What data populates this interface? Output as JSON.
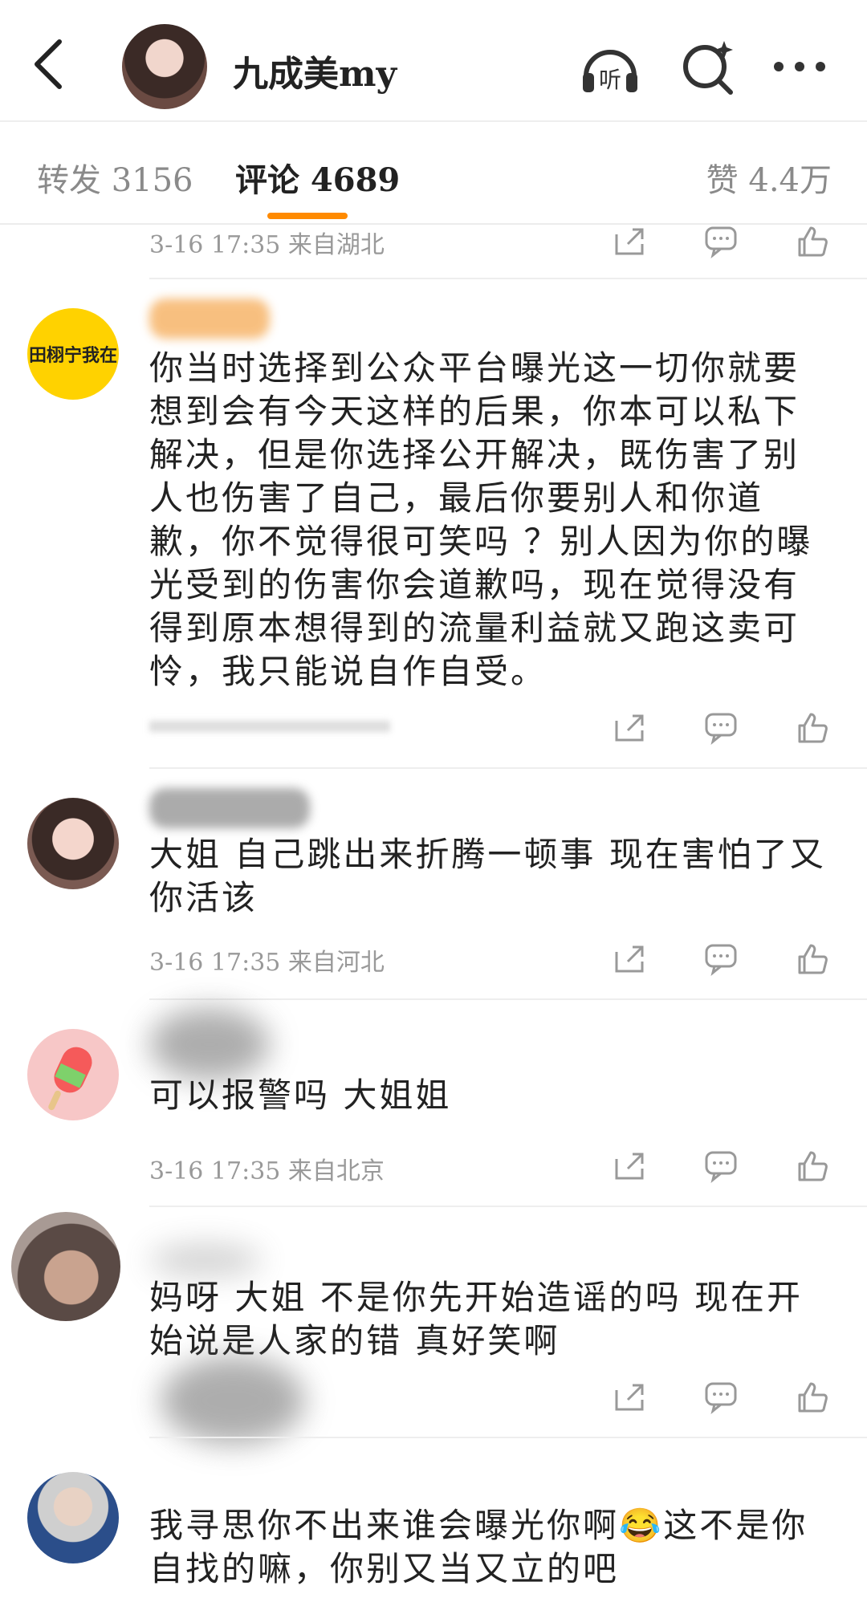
{
  "header": {
    "username": "九成美my",
    "listen_label": "听"
  },
  "tabs": {
    "forward": "转发 3156",
    "comments": "评论 4689",
    "likes": "赞 4.4万"
  },
  "comments": [
    {
      "meta": "3-16 17:35  来自湖北"
    },
    {
      "avatar_text": "田栩宁我在",
      "text": "你当时选择到公众平台曝光这一切你就要想到会有今天这样的后果，你本可以私下解决，但是你选择公开解决，既伤害了别人也伤害了自己，最后你要别人和你道歉，你不觉得很可笑吗 ？别人因为你的曝光受到的伤害你会道歉吗，现在觉得没有得到原本想得到的流量利益就又跑这卖可怜，我只能说自作自受。"
    },
    {
      "text": "大姐 自己跳出来折腾一顿事 现在害怕了又你活该",
      "meta": "3-16 17:35  来自河北"
    },
    {
      "text": "可以报警吗 大姐姐",
      "meta": "3-16 17:35  来自北京"
    },
    {
      "text": "妈呀 大姐 不是你先开始造谣的吗 现在开始说是人家的错 真好笑啊"
    },
    {
      "text": "我寻思你不出来谁会曝光你啊😂这不是你自找的嘛，你别又当又立的吧"
    }
  ],
  "colors": {
    "accent": "#ff8a00",
    "meta_gray": "#999999"
  }
}
